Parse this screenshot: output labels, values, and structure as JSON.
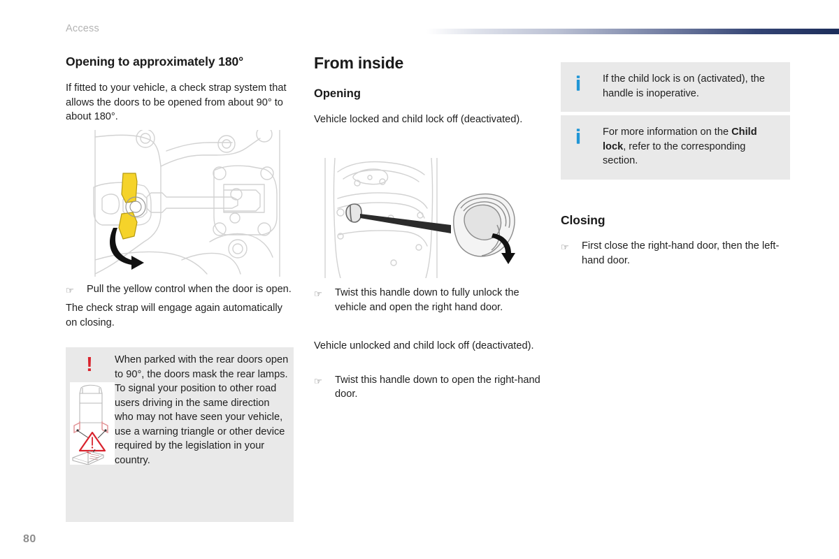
{
  "header": {
    "section_label": "Access",
    "rule_gradient_from": "#ffffff",
    "rule_gradient_to": "#1c2d5a"
  },
  "page_number": "80",
  "colors": {
    "info_box_bg": "#e9e9e9",
    "info_icon_blue": "#2196d6",
    "warning_red": "#d9232d",
    "accent_navy": "#1c2d5a",
    "yellow_control": "#f5d32a",
    "body_text": "#1f1f1f",
    "muted_text": "#b3b3b3"
  },
  "left_column": {
    "heading": "Opening to approximately 180°",
    "intro": "If fitted to your vehicle, a check strap system that allows the doors to be opened from about 90° to about 180°.",
    "illustration_name": "door-check-strap-mechanism-diagram",
    "bullet": {
      "marker": "☞",
      "text": "Pull the yellow control when the door is open."
    },
    "after_bullet": "The check strap will engage again automatically on closing.",
    "warning": {
      "icon": "!",
      "icon_name": "warning-exclamation-icon",
      "illustration_name": "van-rear-doors-warning-triangle-diagram",
      "text": "When parked with the rear doors open to 90°, the doors mask the rear lamps. To signal your position to other road users driving in the same direction who may not have seen your vehicle, use a warning triangle or other device required by the legislation in your country."
    }
  },
  "middle_column": {
    "heading": "From inside",
    "sub_heading": "Opening",
    "intro": "Vehicle locked and child lock off (deactivated).",
    "illustration_name": "interior-door-handle-twist-diagram",
    "bullet_1": {
      "marker": "☞",
      "text": "Twist this handle down to fully unlock the vehicle and open the right hand door."
    },
    "paragraph_2": "Vehicle unlocked and child lock off (deactivated).",
    "bullet_2": {
      "marker": "☞",
      "text": "Twist this handle down to open the right-hand door."
    }
  },
  "right_column": {
    "info_boxes": [
      {
        "icon": "i",
        "icon_name": "info-icon",
        "text": "If the child lock is on (activated), the handle is inoperative."
      },
      {
        "icon": "i",
        "icon_name": "info-icon",
        "text_before": "For more information on the ",
        "text_bold": "Child lock",
        "text_after": ", refer to the corresponding section."
      }
    ],
    "closing_heading": "Closing",
    "closing_bullet": {
      "marker": "☞",
      "text": "First close the right-hand door, then the left-hand door."
    }
  }
}
